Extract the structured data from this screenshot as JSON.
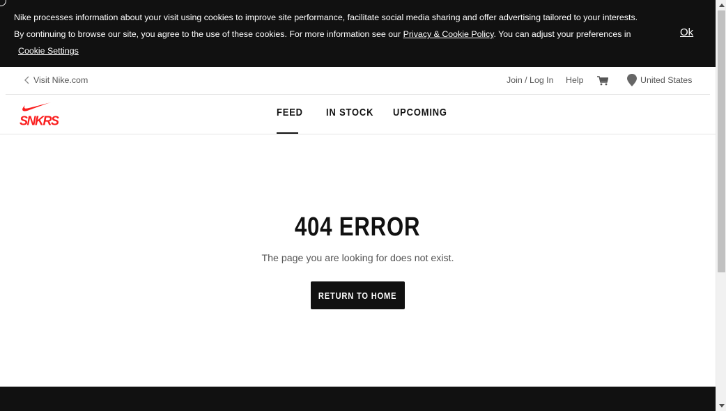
{
  "cookie_banner": {
    "text_before": "Nike processes information about your visit using cookies to improve site performance, facilitate social media sharing and offer advertising tailored to your interests. By continuing to browse our site, you agree to the use of these cookies. For more information see our ",
    "policy_link": "Privacy & Cookie Policy",
    "text_after": ". You can adjust your preferences in",
    "settings_link": "Cookie Settings",
    "ok_label": "Ok"
  },
  "utility_bar": {
    "visit_label": "Visit Nike.com",
    "join_label": "Join / Log In",
    "help_label": "Help",
    "cart_icon": "cart-icon",
    "region_label": "United States",
    "region_icon": "location-pin-icon"
  },
  "nav": {
    "logo_text": "SNKRS",
    "tabs": [
      {
        "label": "FEED",
        "active": true
      },
      {
        "label": "IN STOCK",
        "active": false
      },
      {
        "label": "UPCOMING",
        "active": false
      }
    ]
  },
  "content": {
    "title": "404 ERROR",
    "message": "The page you are looking for does not exist.",
    "button_label": "RETURN TO HOME"
  },
  "colors": {
    "brand_red": "#fa1e1e",
    "dark": "#111111",
    "muted_text": "#555555"
  }
}
